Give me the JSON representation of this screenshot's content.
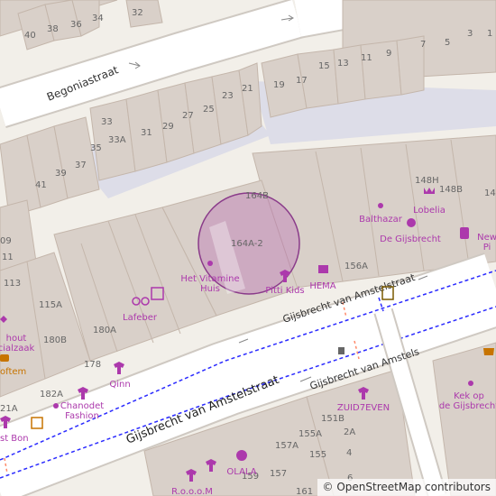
{
  "streets": {
    "amstelstraat_main": "Gijsbrecht van Amstelstraat",
    "amstelstraat_upper": "Gijsbrecht van Amstelstraat",
    "amstelstraat_lower": "Gijsbrecht van Amstels",
    "begonia": "Begoniastraat"
  },
  "house_numbers": [
    "32",
    "40",
    "38",
    "36",
    "34",
    "7",
    "5",
    "3",
    "1",
    "19",
    "17",
    "15",
    "13",
    "11",
    "9",
    "33",
    "33A",
    "31",
    "29",
    "27",
    "25",
    "23",
    "21",
    "35",
    "39",
    "37",
    "41",
    "164B",
    "148H",
    "148B",
    "14",
    "164A-2",
    "156A",
    "09",
    "11",
    "113",
    "115A",
    "180B",
    "180A",
    "178",
    "182A",
    "21A",
    "151B",
    "2A",
    "157A",
    "155A",
    "4",
    "155",
    "6",
    "159",
    "157",
    "161"
  ],
  "pois": {
    "vitamine": "Het Vitamine\nHuis",
    "pitti": "Pitti Kids",
    "hema": "HEMA",
    "balthazar": "Balthazar",
    "lobelia": "Lobelia",
    "gijsbrecht": "De Gijsbrecht",
    "lafeber": "Lafeber",
    "qinn": "Qinn",
    "chanodet": "Chanodet\nFashion",
    "zuid7even": "ZUID7EVEN",
    "kek": "Kek op\nde Gijsbrecht",
    "olala": "OLALA",
    "rooom": "R.o.o.o.M",
    "new_p": "New\nPi",
    "left_hout": "hout\ncialzaak",
    "left_oftem": "oftem",
    "left_stbon": "st Bon"
  },
  "attribution": "© OpenStreetMap contributors",
  "colors": {
    "background": "#f2efe9",
    "building": "#d9d0c9",
    "building_stroke": "#c4b6ab",
    "road": "#ffffff",
    "road_casing": "#cfc9c2",
    "pedestrian": "#dddde8",
    "bus_route": "#2a2aff",
    "poi": "#ac39ac",
    "label": "#555555",
    "marker": "#8a3b8a",
    "food_orange": "#c77400"
  },
  "icons": [
    "clothes-icon",
    "shop-bag-icon",
    "store-icon",
    "flower-icon",
    "cosmetics-icon",
    "eyeglasses-icon",
    "garden-icon",
    "fast-food-icon",
    "bus-stop-icon",
    "waste-basket-icon",
    "cafe-icon",
    "cupcake-icon",
    "dot-icon"
  ],
  "marker_label": "164A-2"
}
